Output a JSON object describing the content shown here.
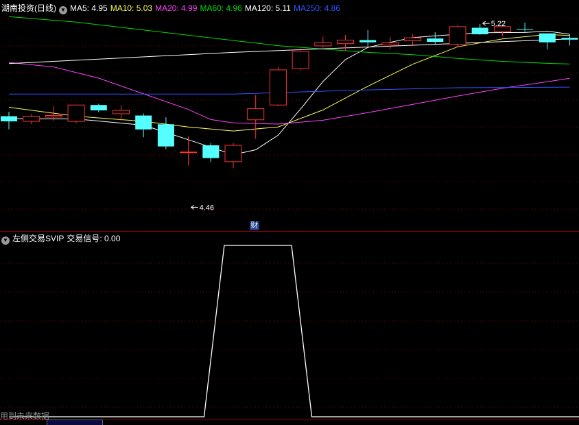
{
  "header": {
    "stock_name": "湖南投资(日线)",
    "ma": [
      {
        "label": "MA5: 4.95",
        "color": "#ffffff"
      },
      {
        "label": "MA10: 5.03",
        "color": "#ffff55"
      },
      {
        "label": "MA20: 4.99",
        "color": "#ff44ff"
      },
      {
        "label": "MA60: 4.96",
        "color": "#00dd00"
      },
      {
        "label": "MA120: 5.11",
        "color": "#ffffff"
      },
      {
        "label": "MA250: 4.86",
        "color": "#3355ff"
      }
    ]
  },
  "indicator": {
    "name": "左侧交易SVIP",
    "signal_label": "交易信号: 0.00"
  },
  "footer": {
    "note": "用到未来数据",
    "financial_marker": "财"
  },
  "colors": {
    "up": "#ff3333",
    "down": "#55ffff",
    "grid": "#7a0000",
    "divider": "#9a0000"
  },
  "chart_data": [
    {
      "type": "candlestick",
      "title": "湖南投资(日线)",
      "price_range": [
        4.4,
        5.3
      ],
      "annotations": [
        {
          "text": "5.22",
          "value": 5.22,
          "candle_index": 21
        },
        {
          "text": "4.46",
          "value": 4.46,
          "candle_index": 8
        }
      ],
      "candles": [
        {
          "o": 4.83,
          "h": 4.85,
          "l": 4.771,
          "c": 4.807
        },
        {
          "o": 4.807,
          "h": 4.84,
          "l": 4.795,
          "c": 4.83
        },
        {
          "o": 4.826,
          "h": 4.874,
          "l": 4.81,
          "c": 4.833
        },
        {
          "o": 4.807,
          "h": 4.88,
          "l": 4.8,
          "c": 4.88
        },
        {
          "o": 4.88,
          "h": 4.885,
          "l": 4.848,
          "c": 4.856
        },
        {
          "o": 4.841,
          "h": 4.88,
          "l": 4.81,
          "c": 4.856
        },
        {
          "o": 4.833,
          "h": 4.842,
          "l": 4.736,
          "c": 4.771
        },
        {
          "o": 4.794,
          "h": 4.825,
          "l": 4.683,
          "c": 4.695
        },
        {
          "o": 4.667,
          "h": 4.74,
          "l": 4.61,
          "c": 4.67
        },
        {
          "o": 4.7,
          "h": 4.71,
          "l": 4.625,
          "c": 4.643
        },
        {
          "o": 4.627,
          "h": 4.71,
          "l": 4.598,
          "c": 4.7
        },
        {
          "o": 4.814,
          "h": 4.925,
          "l": 4.729,
          "c": 4.864
        },
        {
          "o": 4.88,
          "h": 5.05,
          "l": 4.874,
          "c": 5.037
        },
        {
          "o": 5.042,
          "h": 5.133,
          "l": 5.035,
          "c": 5.12
        },
        {
          "o": 5.144,
          "h": 5.185,
          "l": 5.137,
          "c": 5.158
        },
        {
          "o": 5.154,
          "h": 5.193,
          "l": 5.12,
          "c": 5.17
        },
        {
          "o": 5.17,
          "h": 5.215,
          "l": 5.143,
          "c": 5.16
        },
        {
          "o": 5.148,
          "h": 5.183,
          "l": 5.13,
          "c": 5.158
        },
        {
          "o": 5.167,
          "h": 5.196,
          "l": 5.148,
          "c": 5.18
        },
        {
          "o": 5.177,
          "h": 5.205,
          "l": 5.148,
          "c": 5.162
        },
        {
          "o": 5.151,
          "h": 5.236,
          "l": 5.138,
          "c": 5.23
        },
        {
          "o": 5.225,
          "h": 5.242,
          "l": 5.193,
          "c": 5.196
        },
        {
          "o": 5.208,
          "h": 5.236,
          "l": 5.188,
          "c": 5.23
        },
        {
          "o": 5.22,
          "h": 5.248,
          "l": 5.208,
          "c": 5.218
        },
        {
          "o": 5.2,
          "h": 5.2,
          "l": 5.129,
          "c": 5.16
        },
        {
          "o": 5.18,
          "h": 5.195,
          "l": 5.146,
          "c": 5.172
        }
      ],
      "lines": [
        {
          "name": "MA5",
          "color": "#ffffff",
          "points": [
            [
              0,
              4.819
            ],
            [
              3,
              4.818
            ],
            [
              6,
              4.79
            ],
            [
              8,
              4.725
            ],
            [
              10,
              4.658
            ],
            [
              11,
              4.68
            ],
            [
              12,
              4.745
            ],
            [
              13,
              4.862
            ],
            [
              14,
              4.985
            ],
            [
              15,
              5.083
            ],
            [
              16,
              5.137
            ],
            [
              17,
              5.16
            ],
            [
              18,
              5.181
            ],
            [
              19,
              5.189
            ],
            [
              21,
              5.203
            ],
            [
              23,
              5.204
            ],
            [
              24,
              5.21
            ],
            [
              25,
              5.196
            ]
          ]
        },
        {
          "name": "MA10",
          "color": "#ffff55",
          "points": [
            [
              0,
              4.87
            ],
            [
              3,
              4.83
            ],
            [
              6,
              4.807
            ],
            [
              8,
              4.782
            ],
            [
              10,
              4.764
            ],
            [
              12,
              4.782
            ],
            [
              14,
              4.858
            ],
            [
              16,
              4.964
            ],
            [
              18,
              5.062
            ],
            [
              20,
              5.14
            ],
            [
              22,
              5.175
            ],
            [
              24,
              5.195
            ],
            [
              25,
              5.19
            ]
          ]
        },
        {
          "name": "MA20",
          "color": "#ff44ff",
          "points": [
            [
              0,
              5.07
            ],
            [
              2,
              5.05
            ],
            [
              4,
              5.0
            ],
            [
              6,
              4.93
            ],
            [
              8,
              4.86
            ],
            [
              9,
              4.815
            ],
            [
              10,
              4.8
            ],
            [
              12,
              4.795
            ],
            [
              14,
              4.812
            ],
            [
              16,
              4.846
            ],
            [
              18,
              4.883
            ],
            [
              20,
              4.92
            ],
            [
              22,
              4.955
            ],
            [
              24,
              4.984
            ],
            [
              25,
              4.999
            ]
          ]
        },
        {
          "name": "MA60",
          "color": "#00dd00",
          "points": [
            [
              0,
              5.275
            ],
            [
              3,
              5.25
            ],
            [
              6,
              5.215
            ],
            [
              9,
              5.18
            ],
            [
              12,
              5.145
            ],
            [
              14,
              5.13
            ],
            [
              16,
              5.115
            ],
            [
              18,
              5.105
            ],
            [
              20,
              5.088
            ],
            [
              22,
              5.075
            ],
            [
              24,
              5.066
            ],
            [
              25,
              5.063
            ]
          ]
        },
        {
          "name": "MA120",
          "color": "#ffffff",
          "points": [
            [
              0,
              5.065
            ],
            [
              10,
              5.115
            ],
            [
              20,
              5.155
            ],
            [
              25,
              5.175
            ]
          ]
        },
        {
          "name": "MA250",
          "color": "#3355ff",
          "points": [
            [
              0,
              4.929
            ],
            [
              10,
              4.929
            ],
            [
              15,
              4.945
            ],
            [
              20,
              4.957
            ],
            [
              25,
              4.96
            ]
          ]
        }
      ]
    },
    {
      "type": "line",
      "title": "左侧交易SVIP",
      "ylim": [
        0,
        1
      ],
      "series": [
        {
          "name": "交易信号",
          "color": "#ffffff",
          "points": [
            [
              0,
              0
            ],
            [
              8.7,
              0
            ],
            [
              9.6,
              1
            ],
            [
              12.6,
              1
            ],
            [
              13.5,
              0
            ],
            [
              26,
              0
            ]
          ]
        }
      ]
    }
  ]
}
